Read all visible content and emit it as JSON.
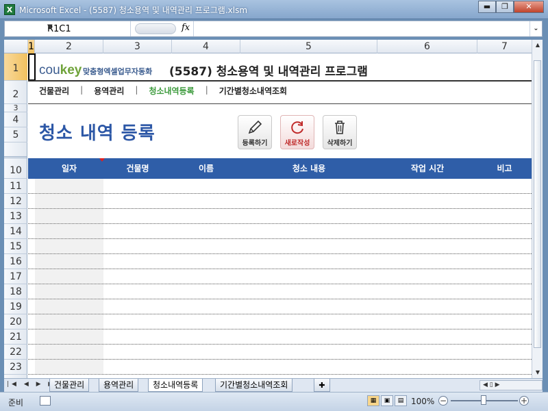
{
  "window": {
    "title": "Microsoft Excel - (5587) 청소용역 및 내역관리 프로그램.xlsm",
    "app_icon": "X"
  },
  "formula_bar": {
    "name_box": "R1C1",
    "fx": "fx",
    "value": ""
  },
  "columns": [
    "1",
    "2",
    "3",
    "4",
    "5",
    "6",
    "7"
  ],
  "rows": [
    "1",
    "2",
    "3",
    "4",
    "5",
    "10",
    "11",
    "12",
    "13",
    "14",
    "15",
    "16",
    "17",
    "18",
    "19",
    "20",
    "21",
    "22",
    "23"
  ],
  "header": {
    "brand_co": "cou",
    "brand_key": "key",
    "brand_sub": "맞춤형엑셀업무자동화",
    "doc_title": "(5587) 청소용역 및 내역관리 프로그램"
  },
  "nav": {
    "items": [
      "건물관리",
      "용역관리",
      "청소내역등록",
      "기간별청소내역조회"
    ],
    "active_index": 2,
    "separator": "|"
  },
  "page": {
    "title": "청소 내역 등록"
  },
  "actions": {
    "register": "등록하기",
    "new": "새로작성",
    "delete": "삭제하기"
  },
  "table": {
    "headers": [
      "일자",
      "건물명",
      "이름",
      "청소 내용",
      "작업 시간",
      "비고"
    ],
    "row_count": 13
  },
  "sheet_tabs": {
    "items": [
      "건물관리",
      "용역관리",
      "청소내역등록",
      "기간별청소내역조회"
    ],
    "active_index": 2,
    "nav_glyphs": "|◀ ◀ ▶ ▶|"
  },
  "status": {
    "ready": "준비",
    "zoom": "100%"
  },
  "colors": {
    "accent_blue": "#2f5ea8",
    "title_blue": "#2c57a6",
    "active_nav": "#3b9a3b",
    "new_button_red": "#c02a2a"
  }
}
